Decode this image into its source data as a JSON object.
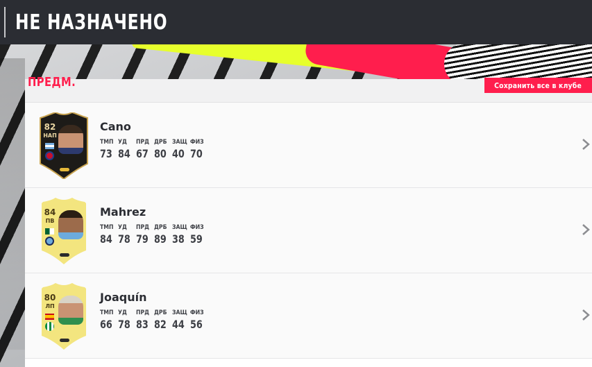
{
  "header": {
    "title": "НЕ НАЗНАЧЕНО"
  },
  "section": {
    "title": "ПРЕДМ.",
    "store_all_label": "Сохранить все в клубе"
  },
  "stat_labels": [
    "ТМП",
    "УД",
    "ПРД",
    "ДРБ",
    "ЗАЩ",
    "ФИЗ"
  ],
  "players": [
    {
      "name": "Cano",
      "rating": "82",
      "position": "НАП",
      "card_type": "black",
      "stats": [
        "73",
        "84",
        "67",
        "80",
        "40",
        "70"
      ]
    },
    {
      "name": "Mahrez",
      "rating": "84",
      "position": "ПВ",
      "card_type": "gold",
      "stats": [
        "84",
        "78",
        "79",
        "89",
        "38",
        "59"
      ]
    },
    {
      "name": "Joaquín",
      "rating": "80",
      "position": "ЛП",
      "card_type": "gold",
      "stats": [
        "66",
        "78",
        "83",
        "82",
        "44",
        "56"
      ]
    }
  ],
  "colors": {
    "accent": "#ff1e4d",
    "header_bg": "#2b2d33",
    "gold_card": "#f3e57f",
    "black_card": "#1d1b18"
  }
}
